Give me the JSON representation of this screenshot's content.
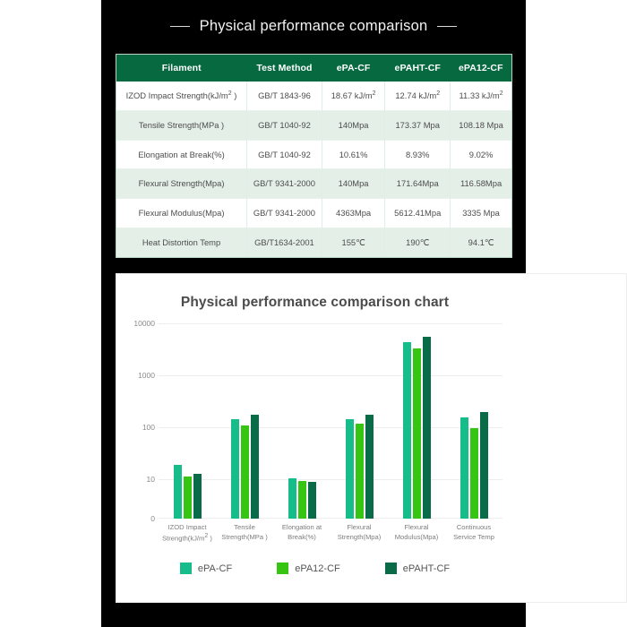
{
  "heading": {
    "text": "Physical performance comparison",
    "dash_left": "—",
    "dash_right": "—"
  },
  "table": {
    "columns": [
      "Filament",
      "Test Method",
      "ePA-CF",
      "ePAHT-CF",
      "ePA12-CF"
    ],
    "rows": [
      {
        "property": "IZOD Impact Strength(kJ/m² )",
        "method": "GB/T 1843-96",
        "epa_cf": "18.67 kJ/m²",
        "epaht_cf": "12.74 kJ/m²",
        "epa12_cf": "11.33 kJ/m²"
      },
      {
        "property": "Tensile Strength(MPa )",
        "method": "GB/T 1040-92",
        "epa_cf": "140Mpa",
        "epaht_cf": "173.37 Mpa",
        "epa12_cf": "108.18 Mpa"
      },
      {
        "property": "Elongation at Break(%)",
        "method": "GB/T 1040-92",
        "epa_cf": "10.61%",
        "epaht_cf": "8.93%",
        "epa12_cf": "9.02%"
      },
      {
        "property": "Flexural Strength(Mpa)",
        "method": "GB/T 9341-2000",
        "epa_cf": "140Mpa",
        "epaht_cf": "171.64Mpa",
        "epa12_cf": "116.58Mpa"
      },
      {
        "property": "Flexural Modulus(Mpa)",
        "method": "GB/T 9341-2000",
        "epa_cf": "4363Mpa",
        "epaht_cf": "5612.41Mpa",
        "epa12_cf": "3335 Mpa"
      },
      {
        "property": "Heat Distortion Temp",
        "method": "GB/T1634-2001",
        "epa_cf": "155℃",
        "epaht_cf": "190℃",
        "epa12_cf": "94.1℃"
      }
    ]
  },
  "chart_data": {
    "type": "bar",
    "title": "Physical performance comparison chart",
    "xlabel": "",
    "ylabel": "",
    "yscale": "log",
    "ylim": [
      0,
      10000
    ],
    "yticks": [
      "0",
      "10",
      "100",
      "1000",
      "10000"
    ],
    "grid": true,
    "legend_position": "bottom",
    "categories": [
      "IZOD Impact\nStrength(kJ/m² )",
      "Tensile\nStrength(MPa )",
      "Elongation at\nBreak(%)",
      "Flexural\nStrength(Mpa)",
      "Flexural\nModulus(Mpa)",
      "Continuous\nService Temp"
    ],
    "series": [
      {
        "name": "ePA-CF",
        "color": "#16bd8b",
        "values": [
          18.67,
          140,
          10.61,
          140,
          4363,
          155
        ]
      },
      {
        "name": "ePA12-CF",
        "color": "#35c512",
        "values": [
          11.33,
          108.18,
          9.02,
          116.58,
          3335,
          94.1
        ]
      },
      {
        "name": "ePAHT-CF",
        "color": "#096b47",
        "values": [
          12.74,
          173.37,
          8.93,
          171.64,
          5612.41,
          190
        ]
      }
    ]
  },
  "colors": {
    "panel_background": "#000000",
    "table_header": "#066940",
    "table_row_alt": "#e4efe8",
    "series_epa_cf": "#16bd8b",
    "series_epa12_cf": "#35c512",
    "series_epaht_cf": "#096b47"
  }
}
